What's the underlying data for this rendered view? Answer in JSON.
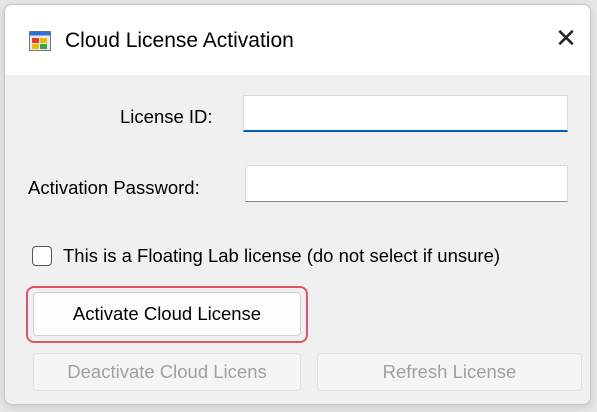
{
  "window": {
    "title": "Cloud License Activation",
    "app_icon": "windows-app-icon",
    "close_icon": "close-icon",
    "close_glyph": "✕"
  },
  "form": {
    "license_id_label": "License ID:",
    "license_id_value": "",
    "activation_password_label": "Activation Password:",
    "activation_password_value": "",
    "floating_lab_checkbox_label": "This is a Floating Lab license (do not select if unsure)",
    "floating_lab_checked": false
  },
  "buttons": {
    "activate_label": "Activate Cloud License",
    "deactivate_label": "Deactivate Cloud Licens",
    "refresh_label": "Refresh License"
  },
  "colors": {
    "highlight": "#e05565",
    "focus_accent": "#005fb8",
    "disabled_text": "#a0a0a0"
  }
}
